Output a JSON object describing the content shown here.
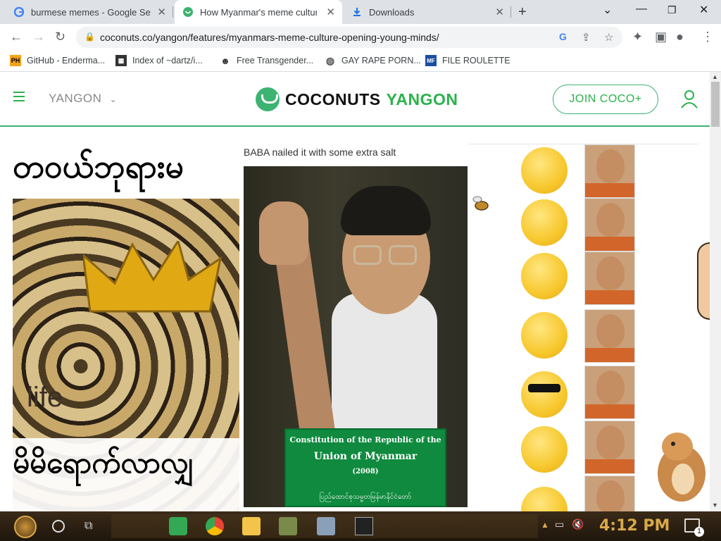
{
  "browser": {
    "tabs": [
      {
        "label": "burmese memes - Google Search",
        "favicon": "google-icon",
        "active": false
      },
      {
        "label": "How Myanmar's meme culture is opening young minds",
        "favicon": "coconuts-icon",
        "active": true
      },
      {
        "label": "Downloads",
        "favicon": "download-icon",
        "active": false
      }
    ],
    "new_tab_glyph": "+",
    "url": "coconuts.co/yangon/features/myanmars-meme-culture-opening-young-minds/",
    "bookmarks": [
      {
        "label": "GitHub - Enderma...",
        "icon": "PH"
      },
      {
        "label": "Index of ~dartz/i...",
        "icon": "index-icon"
      },
      {
        "label": "Free Transgender...",
        "icon": "mask-icon"
      },
      {
        "label": "GAY RAPE PORN...",
        "icon": "globe-icon"
      },
      {
        "label": "FILE ROULETTE",
        "icon": "MF"
      }
    ]
  },
  "site": {
    "city": "YANGON",
    "logo_word1": "COCONUTS",
    "logo_word2": "YANGON",
    "join_label": "JOIN COCO+",
    "brand_color": "#2bb24c"
  },
  "article": {
    "meme1": {
      "top_text": "တဝယ်ဘုရားမ",
      "overlay_text": "life",
      "bottom_text": "မိမိရောက်လာလျှ"
    },
    "meme2": {
      "caption": "BABA nailed it with some extra salt",
      "book_line1": "Constitution of the Republic of the",
      "book_line2": "Union of Myanmar",
      "book_line3": "(2008)",
      "book_line4": "ပြည်ထောင်စုသမ္မတမြန်မာနိုင်ငံတော်"
    }
  },
  "taskbar": {
    "time": "4:12 PM",
    "notification_count": "1"
  }
}
